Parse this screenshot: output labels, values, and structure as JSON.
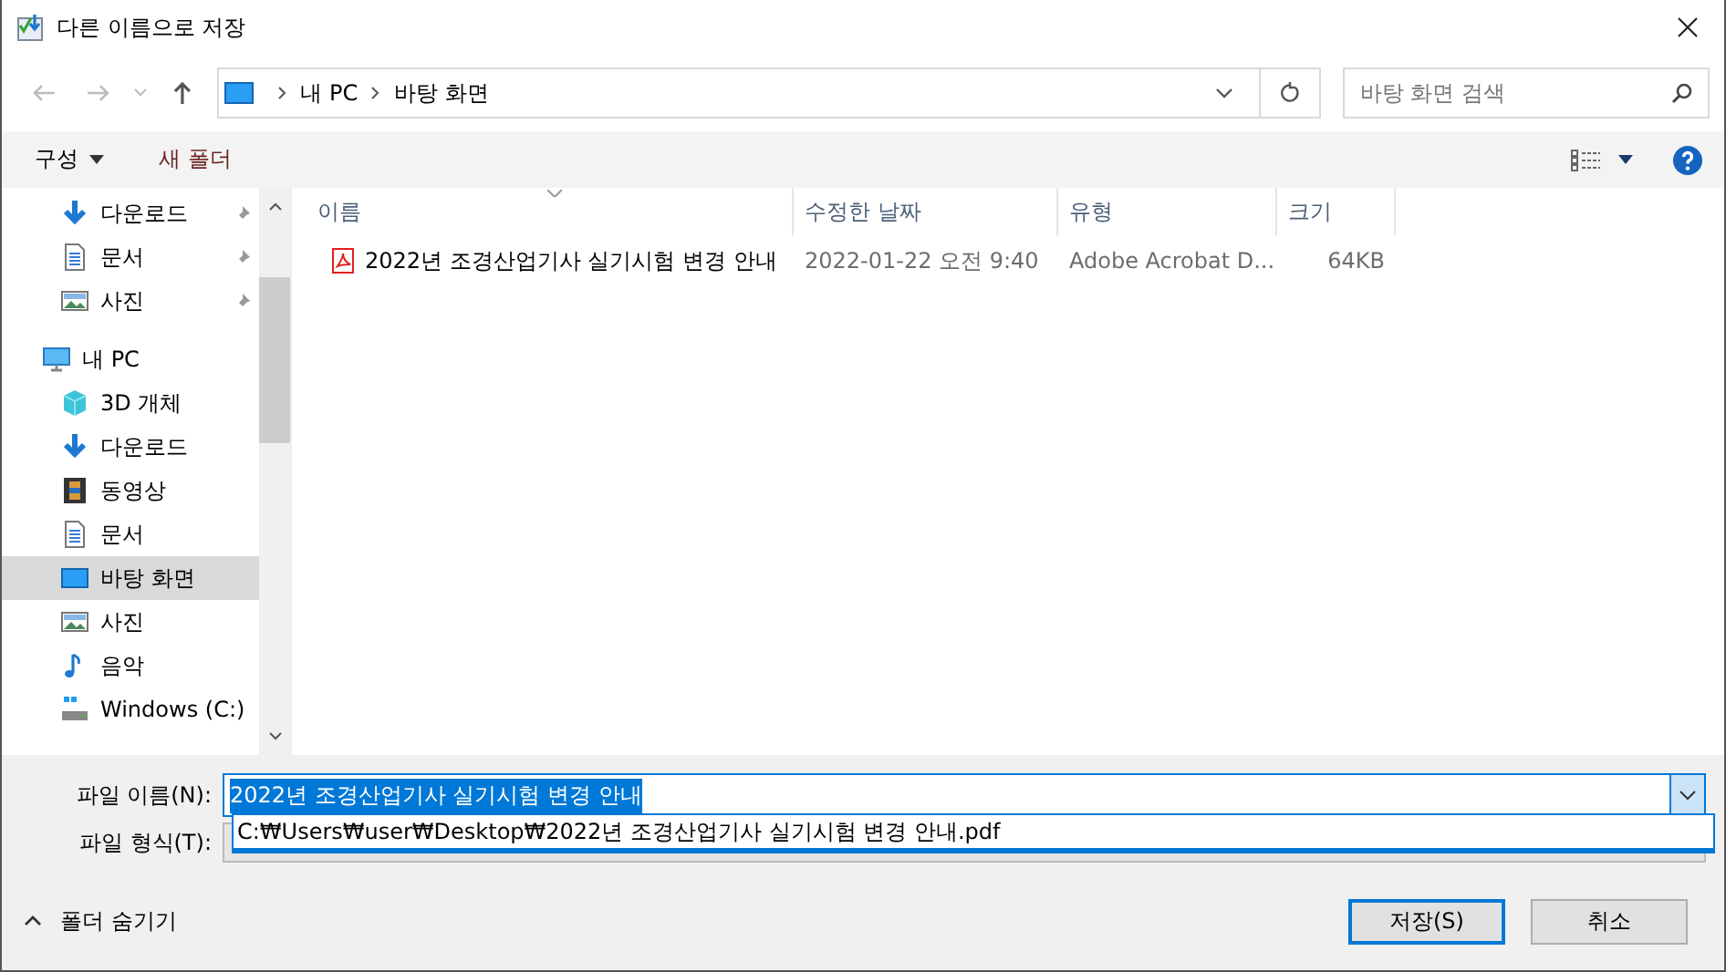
{
  "window": {
    "title": "다른 이름으로 저장"
  },
  "address": {
    "crumbs": [
      "내 PC",
      "바탕 화면"
    ]
  },
  "search": {
    "placeholder": "바탕 화면 검색"
  },
  "toolbar": {
    "organize": "구성",
    "new_folder": "새 폴더"
  },
  "sidebar": {
    "items": [
      {
        "label": "다운로드",
        "kind": "download",
        "pinned": true,
        "selected": false
      },
      {
        "label": "문서",
        "kind": "document",
        "pinned": true,
        "selected": false
      },
      {
        "label": "사진",
        "kind": "photo",
        "pinned": true,
        "selected": false
      },
      {
        "label": "내 PC",
        "kind": "pc",
        "pinned": false,
        "selected": false,
        "children": [
          {
            "label": "3D 개체",
            "kind": "cube",
            "pinned": false,
            "selected": false
          },
          {
            "label": "다운로드",
            "kind": "download",
            "pinned": false,
            "selected": false
          },
          {
            "label": "동영상",
            "kind": "film",
            "pinned": false,
            "selected": false
          },
          {
            "label": "문서",
            "kind": "document",
            "pinned": false,
            "selected": false
          },
          {
            "label": "바탕 화면",
            "kind": "desktop",
            "pinned": false,
            "selected": true
          },
          {
            "label": "사진",
            "kind": "photo",
            "pinned": false,
            "selected": false
          },
          {
            "label": "음악",
            "kind": "music",
            "pinned": false,
            "selected": false
          },
          {
            "label": "Windows (C:)",
            "kind": "drive",
            "pinned": false,
            "selected": false
          }
        ]
      }
    ]
  },
  "table": {
    "columns": [
      "이름",
      "수정한 날짜",
      "유형",
      "크기"
    ],
    "rows": [
      {
        "name": "2022년 조경산업기사 실기시험 변경 안내",
        "modified": "2022-01-22 오전 9:40",
        "type": "Adobe Acrobat D...",
        "size": "64KB",
        "selected": false
      }
    ]
  },
  "form": {
    "file_name_label": "파일 이름(N):",
    "file_name_value": "2022년 조경산업기사 실기시험 변경 안내",
    "file_type_label": "파일 형식(T):",
    "suggestions": [
      "C:₩Users₩user₩Desktop₩2022년 조경산업기사 실기시험 변경 안내.pdf"
    ]
  },
  "footer": {
    "hide_folders": "폴더 숨기기",
    "buttons": [
      {
        "label": "저장(S)",
        "default": true
      },
      {
        "label": "취소",
        "default": false
      }
    ]
  }
}
